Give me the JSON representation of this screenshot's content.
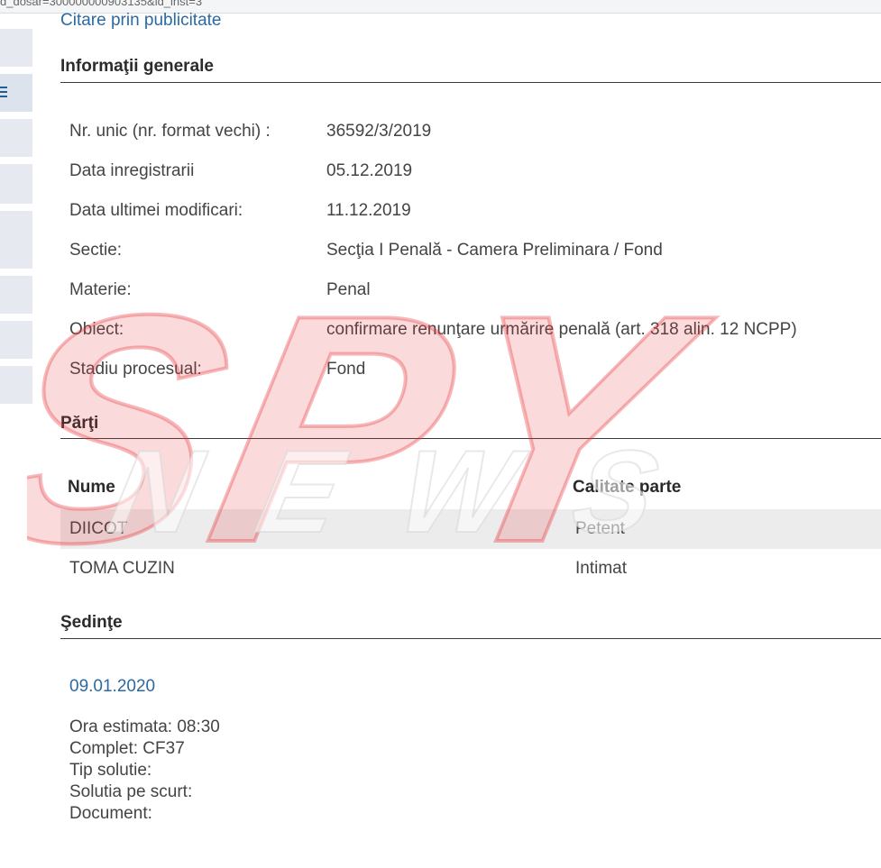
{
  "browser": {
    "url_fragment": "d_dosar=300000000903135&id_inst=3"
  },
  "top_link": "Citare prin publicitate",
  "general_info": {
    "title": "Informaţii generale",
    "rows": [
      {
        "label": "Nr. unic (nr. format vechi) :",
        "value": "36592/3/2019"
      },
      {
        "label": "Data inregistrarii",
        "value": "05.12.2019"
      },
      {
        "label": "Data ultimei modificari:",
        "value": "11.12.2019"
      },
      {
        "label": "Sectie:",
        "value": "Secţia I Penală - Camera Preliminara / Fond"
      },
      {
        "label": "Materie:",
        "value": "Penal"
      },
      {
        "label": "Obiect:",
        "value": "confirmare renunţare urmărire penală (art. 318 alin. 12 NCPP)"
      },
      {
        "label": "Stadiu procesual:",
        "value": "Fond"
      }
    ]
  },
  "parties": {
    "title": "Părţi",
    "columns": {
      "name": "Nume",
      "role": "Calitate parte"
    },
    "rows": [
      {
        "name": "DIICOT",
        "role": "Petent"
      },
      {
        "name": "TOMA CUZIN",
        "role": "Intimat"
      }
    ]
  },
  "hearings": {
    "title": "Şedinţe",
    "date": "09.01.2020",
    "lines": [
      "Ora estimata: 08:30",
      "Complet: CF37",
      "Tip solutie:",
      "Solutia pe scurt:",
      "Document:"
    ]
  },
  "watermark": {
    "line1": "SPY",
    "line2": "NEWS",
    "color1": "#e8343a",
    "color2": "#ffffff"
  },
  "colors": {
    "link": "#2b6aa3",
    "row_alt": "#ececec",
    "sidebar": "#e6e9ef"
  }
}
